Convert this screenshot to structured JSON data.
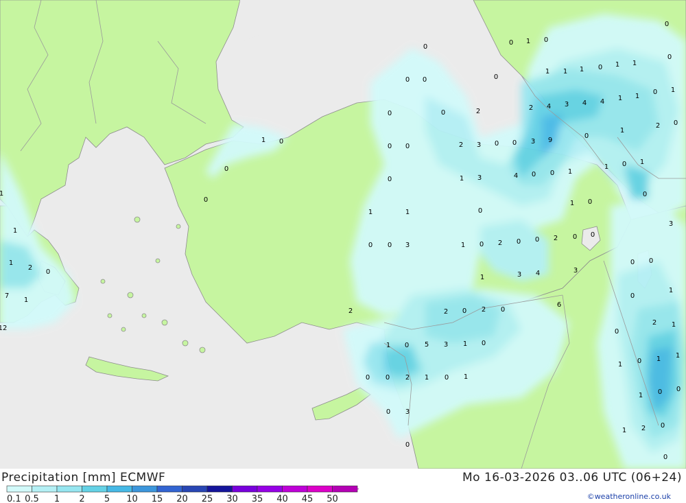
{
  "map": {
    "colors": {
      "sea": "#ebebeb",
      "land": "#c6f5a0",
      "border": "#9a9a9a"
    },
    "precipitation_labels": [
      "0",
      "0",
      "1",
      "0",
      "0",
      "0",
      "1",
      "1",
      "1",
      "0",
      "1",
      "1",
      "0",
      "0",
      "0",
      "2",
      "2",
      "4",
      "3",
      "4",
      "4",
      "1",
      "1",
      "0",
      "1",
      "0",
      "0",
      "2",
      "3",
      "0",
      "0",
      "3",
      "9",
      "0",
      "2",
      "0",
      "1",
      "0",
      "0",
      "1",
      "0",
      "1",
      "3",
      "4",
      "0",
      "0",
      "1",
      "1",
      "0",
      "1",
      "0",
      "0",
      "0",
      "0",
      "1",
      "0",
      "1",
      "1",
      "0",
      "3",
      "1",
      "1",
      "0",
      "0",
      "2",
      "0",
      "0",
      "2",
      "0",
      "1",
      "0",
      "0",
      "3",
      "1",
      "2",
      "0",
      "0",
      "0",
      "3",
      "4",
      "3",
      "1",
      "1",
      "0",
      "7",
      "1",
      "6",
      "0",
      "2",
      "0",
      "2",
      "2",
      "2",
      "0",
      "1",
      "12",
      "1",
      "0",
      "5",
      "3",
      "1",
      "0",
      "1",
      "1",
      "0",
      "1",
      "0",
      "0",
      "2",
      "1",
      "0",
      "1",
      "1",
      "0",
      "0",
      "0",
      "3",
      "1",
      "2",
      "0",
      "0",
      "0"
    ]
  },
  "footer": {
    "title": "Precipitation [mm] ECMWF",
    "datetime": "Mo 16-03-2026 03..06 UTC (06+24)",
    "credit": "©weatheronline.co.uk"
  },
  "legend": {
    "ticks": [
      "0.1",
      "0.5",
      "1",
      "2",
      "5",
      "10",
      "15",
      "20",
      "25",
      "30",
      "35",
      "40",
      "45",
      "50"
    ],
    "colors": [
      "#d2fafa",
      "#b4f0f5",
      "#96e6f0",
      "#64d2e6",
      "#46b9e6",
      "#3c96dc",
      "#3264d2",
      "#2846b4",
      "#14149b",
      "#7800dc",
      "#9600e6",
      "#be00d7",
      "#dc00c8",
      "#b400b4"
    ]
  }
}
